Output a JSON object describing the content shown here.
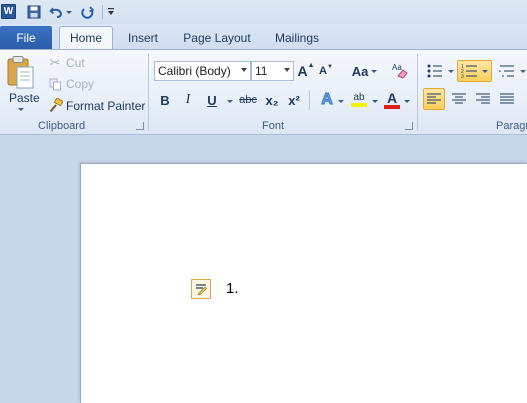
{
  "qat": {
    "app_icon": "word-app-icon",
    "save_icon": "save-icon",
    "undo_icon": "undo-icon",
    "redo_icon": "redo-icon",
    "customize_icon": "customize-qat-icon"
  },
  "tabs": {
    "file": "File",
    "items": [
      "Home",
      "Insert",
      "Page Layout",
      "Mailings"
    ],
    "active": "Home"
  },
  "clipboard": {
    "paste": "Paste",
    "cut": "Cut",
    "copy": "Copy",
    "format_painter": "Format Painter",
    "label": "Clipboard"
  },
  "font": {
    "family": "Calibri (Body)",
    "size": "11",
    "label": "Font",
    "bold": "B",
    "italic": "I",
    "underline": "U",
    "strike": "abc",
    "subscript": "x₂",
    "superscript": "x²",
    "grow": "A",
    "shrink": "A",
    "change_case": "Aa",
    "font_color_letter": "A",
    "highlight_letter": "ab",
    "text_effects_letter": "A",
    "font_color": "#e0201c",
    "highlight_color": "#f2f20a"
  },
  "paragraph": {
    "label": "Paragr"
  },
  "document": {
    "list_number": "1."
  }
}
